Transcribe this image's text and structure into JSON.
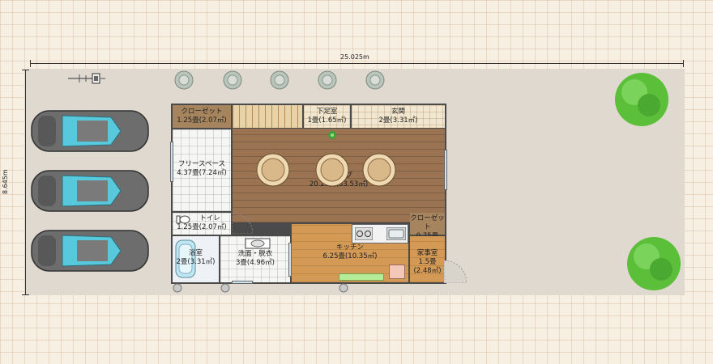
{
  "dimensions": {
    "width_label": "25.025m",
    "height_label": "8.645m"
  },
  "rooms": {
    "closet_nw": {
      "name": "クローゼット",
      "area": "1.25畳(2.07㎡)"
    },
    "shoe_room": {
      "name": "下足室",
      "area": "1畳(1.65㎡)"
    },
    "entrance": {
      "name": "玄関",
      "area": "2畳(3.31㎡)"
    },
    "free_space": {
      "name": "フリースペース",
      "area": "4.37畳(7.24㎡)"
    },
    "living": {
      "name": "リビング",
      "area": "20.25畳(33.53㎡)"
    },
    "toilet": {
      "name": "トイレ",
      "area": "1.25畳(2.07㎡)"
    },
    "closet_se": {
      "name": "クローゼット",
      "area": "0.75畳(1.24㎡)"
    },
    "bath": {
      "name": "浴室",
      "area": "2畳(3.31㎡)"
    },
    "washroom": {
      "name": "洗面・脱衣",
      "area": "3畳(4.96㎡)"
    },
    "kitchen": {
      "name": "キッチン",
      "area": "6.25畳(10.35㎡)"
    },
    "utility": {
      "name": "家事室",
      "area": "1.5畳(2.48㎡)"
    }
  },
  "colors": {
    "wood_floor": "#9a7452",
    "kitchen_floor": "#d49a55",
    "tree_green": "#5bbf3a",
    "car_body": "#6d6d6d",
    "car_glass": "#58c8dc"
  },
  "icons": [
    "car-icon",
    "tree-icon",
    "shrub-icon",
    "bicycle-icon",
    "stool-icon",
    "bathtub-icon",
    "toilet-icon",
    "sink-icon",
    "stove-icon",
    "plant-icon"
  ]
}
